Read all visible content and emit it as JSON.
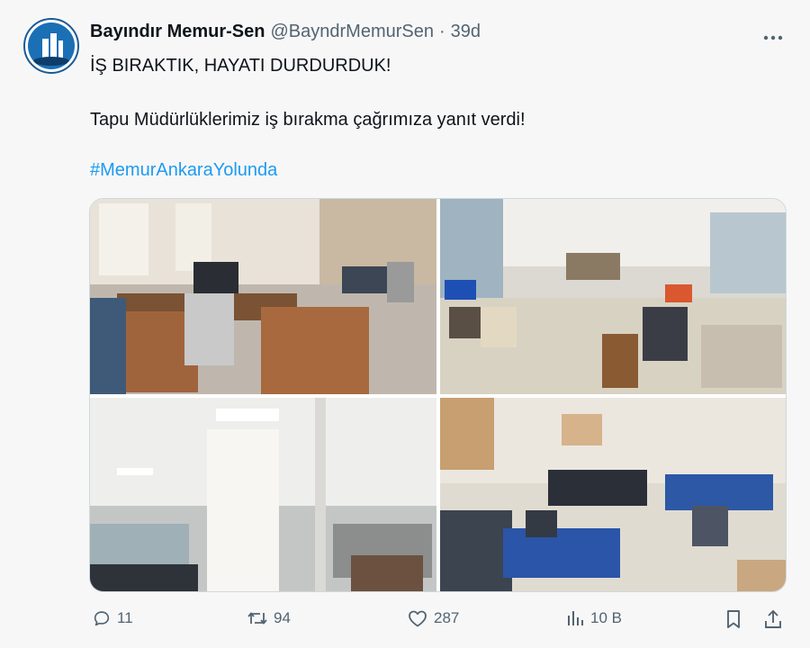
{
  "tweet": {
    "display_name": "Bayındır Memur-Sen",
    "handle": "@BayndrMemurSen",
    "separator": "·",
    "age": "39d",
    "line1": "İŞ BIRAKTIK, HAYATI DURDURDUK!",
    "line2": "Tapu Müdürlüklerimiz iş bırakma çağrımıza yanıt verdi!",
    "hashtag": "#MemurAnkaraYolunda",
    "more_icon": "more-horizontal-icon"
  },
  "media": {
    "photos": [
      {
        "description_icon": "office-photo-1"
      },
      {
        "description_icon": "office-photo-2"
      },
      {
        "description_icon": "office-photo-3"
      },
      {
        "description_icon": "office-photo-4"
      }
    ]
  },
  "actions": {
    "reply_count": "11",
    "retweet_count": "94",
    "like_count": "287",
    "views_count": "10 B"
  },
  "colors": {
    "link": "#1d9bf0",
    "secondary_text": "#536471",
    "primary_text": "#0f1419"
  }
}
